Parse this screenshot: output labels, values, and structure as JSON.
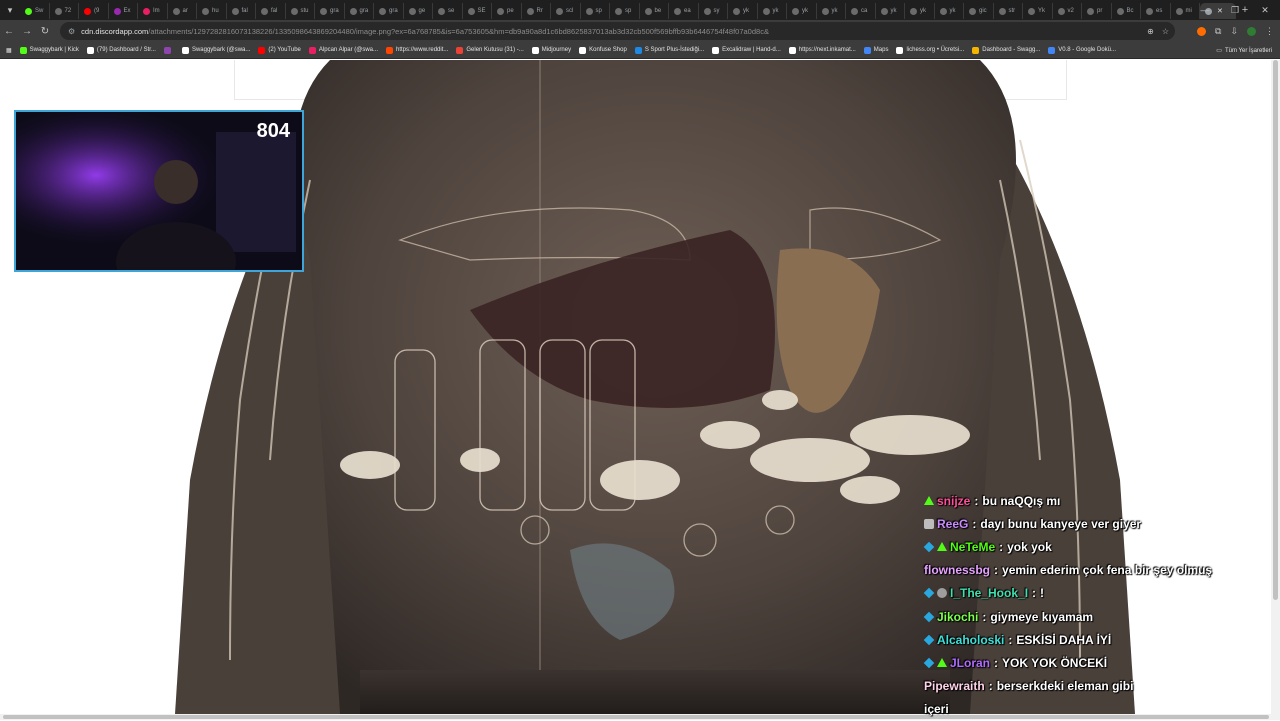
{
  "browser": {
    "tabs": [
      {
        "label": "Sw",
        "fav": "#53fc18"
      },
      {
        "label": "72",
        "fav": "#6b6b6b"
      },
      {
        "label": "(9",
        "fav": "#ff0000"
      },
      {
        "label": "Ex",
        "fav": "#9c27b0"
      },
      {
        "label": "Im",
        "fav": "#e91e63"
      },
      {
        "label": "ar",
        "fav": "#6b6b6b"
      },
      {
        "label": "hu",
        "fav": "#6b6b6b"
      },
      {
        "label": "fal",
        "fav": "#6b6b6b"
      },
      {
        "label": "fal",
        "fav": "#6b6b6b"
      },
      {
        "label": "stu",
        "fav": "#6b6b6b"
      },
      {
        "label": "gra",
        "fav": "#6b6b6b"
      },
      {
        "label": "gra",
        "fav": "#6b6b6b"
      },
      {
        "label": "gra",
        "fav": "#6b6b6b"
      },
      {
        "label": "ge",
        "fav": "#6b6b6b"
      },
      {
        "label": "se",
        "fav": "#6b6b6b"
      },
      {
        "label": "SE",
        "fav": "#6b6b6b"
      },
      {
        "label": "pe",
        "fav": "#6b6b6b"
      },
      {
        "label": "Rr",
        "fav": "#6b6b6b"
      },
      {
        "label": "scl",
        "fav": "#6b6b6b"
      },
      {
        "label": "sp",
        "fav": "#6b6b6b"
      },
      {
        "label": "sp",
        "fav": "#6b6b6b"
      },
      {
        "label": "be",
        "fav": "#6b6b6b"
      },
      {
        "label": "ea",
        "fav": "#6b6b6b"
      },
      {
        "label": "sy",
        "fav": "#6b6b6b"
      },
      {
        "label": "yk",
        "fav": "#6b6b6b"
      },
      {
        "label": "yk",
        "fav": "#6b6b6b"
      },
      {
        "label": "yk",
        "fav": "#6b6b6b"
      },
      {
        "label": "yk",
        "fav": "#6b6b6b"
      },
      {
        "label": "ca",
        "fav": "#6b6b6b"
      },
      {
        "label": "yk",
        "fav": "#6b6b6b"
      },
      {
        "label": "yk",
        "fav": "#6b6b6b"
      },
      {
        "label": "yk",
        "fav": "#6b6b6b"
      },
      {
        "label": "gic",
        "fav": "#6b6b6b"
      },
      {
        "label": "str",
        "fav": "#6b6b6b"
      },
      {
        "label": "Yk",
        "fav": "#6b6b6b"
      },
      {
        "label": "v2",
        "fav": "#6b6b6b"
      },
      {
        "label": "pr",
        "fav": "#6b6b6b"
      },
      {
        "label": "Bc",
        "fav": "#6b6b6b"
      },
      {
        "label": "es",
        "fav": "#6b6b6b"
      },
      {
        "label": "mi",
        "fav": "#6b6b6b"
      }
    ],
    "active_tab_index": 40,
    "new_tab": "+",
    "url_host": "cdn.discordapp.com",
    "url_path": "/attachments/1297282816073138226/1335098643869204480/image.png?ex=6a768785&is=6a753605&hm=db9a90a8d1c6bd8625837013ab3d32cb500f569bffb93b6446754f48f07a0d8c&",
    "bookmarks": [
      {
        "label": "Swaggybark | Kick",
        "color": "#53fc18"
      },
      {
        "label": "(79) Dashboard / Str...",
        "color": "#ffffff"
      },
      {
        "label": "",
        "color": "#8e44ad"
      },
      {
        "label": "Swaggybark (@swa...",
        "color": "#ffffff"
      },
      {
        "label": "(2) YouTube",
        "color": "#ff0000"
      },
      {
        "label": "Alpcan Alpar (@swa...",
        "color": "#e91e63"
      },
      {
        "label": "https://www.reddit...",
        "color": "#ff4500"
      },
      {
        "label": "Gelen Kutusu (31) -...",
        "color": "#ea4335"
      },
      {
        "label": "Midjourney",
        "color": "#ffffff"
      },
      {
        "label": "Konfuse Shop",
        "color": "#ffffff"
      },
      {
        "label": "S Sport Plus-İstediği...",
        "color": "#1e88e5"
      },
      {
        "label": "Excalidraw | Hand-d...",
        "color": "#ffffff"
      },
      {
        "label": "https://next.inkamat...",
        "color": "#ffffff"
      },
      {
        "label": "Maps",
        "color": "#4285f4"
      },
      {
        "label": "lichess.org • Ücretsi...",
        "color": "#ffffff"
      },
      {
        "label": "Dashboard - Swagg...",
        "color": "#f4b400"
      },
      {
        "label": "V0.8 - Google Dokü...",
        "color": "#4285f4"
      }
    ],
    "all_bookmarks": "Tüm Yer İşaretleri"
  },
  "overlay": {
    "viewer_count": "804",
    "chat": [
      {
        "badge": "tri",
        "user": "snijze",
        "color": "#ff4f9a",
        "msg": "bu naQQış mı"
      },
      {
        "badge": "gray",
        "user": "ReeG",
        "color": "#c98bff",
        "msg": "dayı bunu kanyeye ver giyer"
      },
      {
        "badge": "cube+tri",
        "user": "NeTeMe",
        "color": "#53fc18",
        "msg": "yok yok"
      },
      {
        "badge": "",
        "user": "flownessbg",
        "color": "#e6a3ff",
        "msg": "yemin ederim çok fena bir şey olmuş"
      },
      {
        "badge": "cube+dot",
        "user": "I_The_Hook_I",
        "color": "#3fe0b0",
        "msg": "!"
      },
      {
        "badge": "cube",
        "user": "Jikochi",
        "color": "#7cff4f",
        "msg": "giymeye kıyamam"
      },
      {
        "badge": "cube",
        "user": "Alcaholoski",
        "color": "#3fe0d8",
        "msg": "ESKİSİ DAHA İYİ"
      },
      {
        "badge": "cube+tri",
        "user": "JLoran",
        "color": "#b06cff",
        "msg": "YOK YOK ÖNCEKİ"
      },
      {
        "badge": "",
        "user": "Pipewraith",
        "color": "#ffd3e8",
        "msg": "berserkdeki eleman gibi"
      },
      {
        "badge": "",
        "user": "",
        "color": "#ffffff",
        "msg": "içeri"
      }
    ]
  }
}
